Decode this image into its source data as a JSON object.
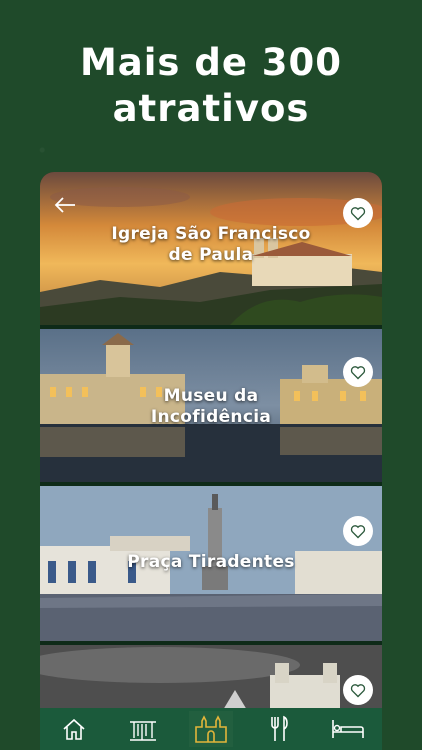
{
  "headline": {
    "line1": "Mais de 300",
    "line2": "atrativos"
  },
  "attractions": [
    {
      "name_l1": "Igreja São Francisco",
      "name_l2": "de Paula",
      "favorite": false
    },
    {
      "name_l1": "Museu da",
      "name_l2": "Incofidência",
      "favorite": false
    },
    {
      "name_l1": "Praça Tiradentes",
      "name_l2": "",
      "favorite": false
    },
    {
      "name_l1": "",
      "name_l2": "",
      "favorite": false
    }
  ],
  "tabbar": {
    "items": [
      "home-icon",
      "waterfall-icon",
      "church-icon",
      "restaurant-icon",
      "hotel-icon"
    ],
    "active_index": 2
  },
  "colors": {
    "background": "#1f4a2a",
    "tabbar": "#1b5a3b",
    "active_tab_icon": "#e3b53a",
    "icon": "#ffffff"
  }
}
